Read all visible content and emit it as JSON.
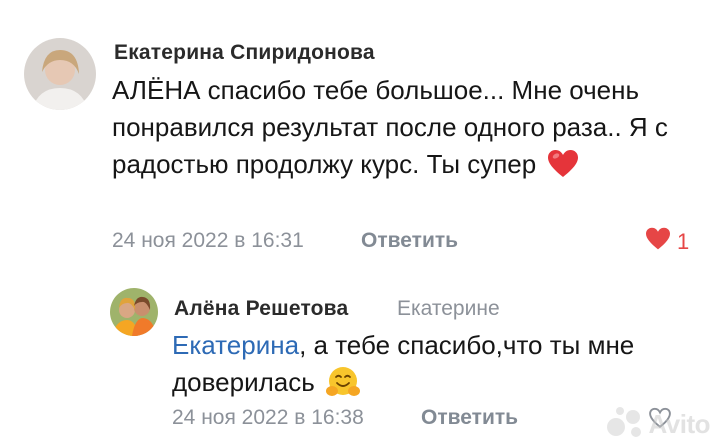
{
  "comments": [
    {
      "author": "Екатерина Спиридонова",
      "text": "АЛЁНА спасибо тебе большое... Мне очень понравился результат после одного раза.. Я с радостью продолжу курс. Ты супер",
      "emoji": "heart-emoji",
      "date": "24 ноя 2022 в 16:31",
      "reply_label": "Ответить",
      "likes": "1",
      "liked": true
    }
  ],
  "replies": [
    {
      "author": "Алёна Решетова",
      "reply_to": "Екатерине",
      "mention": "Екатерина",
      "text": ", а тебе спасибо,что ты мне доверилась",
      "emoji": "hugging-face-emoji",
      "date": "24 ноя 2022 в 16:38",
      "reply_label": "Ответить"
    }
  ],
  "watermark": "Avito",
  "colors": {
    "accent": "#2d6ab5",
    "like": "#e64646",
    "muted": "#8c9199"
  }
}
